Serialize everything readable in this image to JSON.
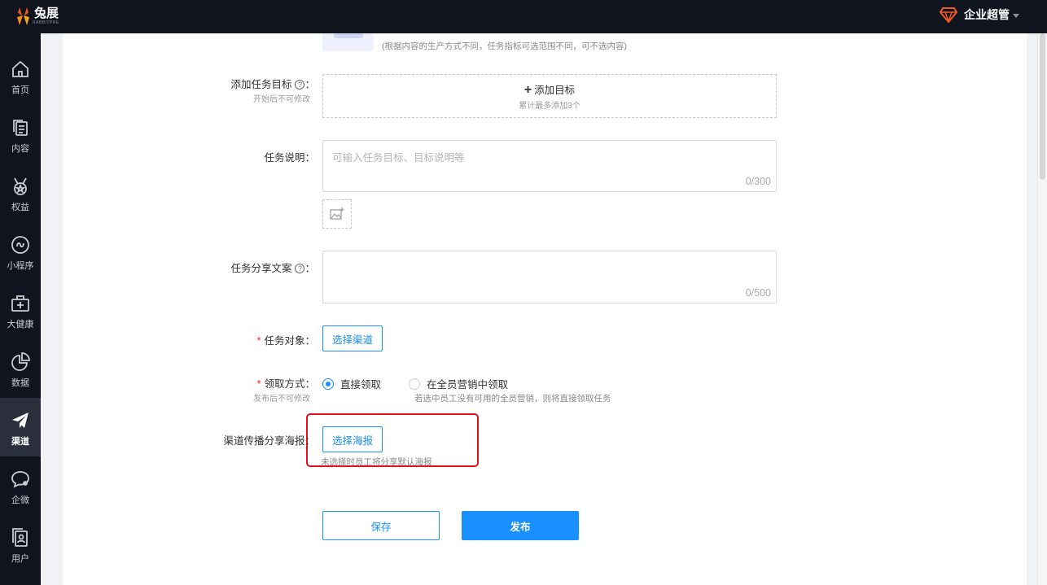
{
  "brand": {
    "name": "兔展",
    "sub": "RABBITPRE"
  },
  "user": {
    "name": "企业超管"
  },
  "colors": {
    "primary": "#1890ff",
    "sidebar_bg": "#10141f",
    "required": "#f5222d",
    "highlight": "#e5101d"
  },
  "sidebar": {
    "items": [
      {
        "label": "首页",
        "icon": "home-icon"
      },
      {
        "label": "内容",
        "icon": "document-copy-icon"
      },
      {
        "label": "权益",
        "icon": "medal-icon"
      },
      {
        "label": "小程序",
        "icon": "mini-program-icon"
      },
      {
        "label": "大健康",
        "icon": "medical-kit-icon"
      },
      {
        "label": "数据",
        "icon": "pie-chart-icon"
      },
      {
        "label": "渠道",
        "icon": "paper-plane-icon",
        "active": true
      },
      {
        "label": "企微",
        "icon": "chat-bubble-icon"
      },
      {
        "label": "用户",
        "icon": "user-card-icon"
      }
    ]
  },
  "form": {
    "upload_hint": "(根据内容的生产方式不同，任务指标可选范围不同，可不选内容)",
    "target": {
      "label": "添加任务目标",
      "sublabel": "开始后不可修改",
      "add_text": "添加目标",
      "add_hint": "累计最多添加3个"
    },
    "description": {
      "label": "任务说明",
      "placeholder": "可输入任务目标、目标说明等",
      "count": "0/300"
    },
    "share_copy": {
      "label": "任务分享文案",
      "count": "0/500"
    },
    "audience": {
      "label": "任务对象",
      "button": "选择渠道"
    },
    "claim": {
      "label": "领取方式",
      "sublabel": "发布后不可修改",
      "option1": "直接领取",
      "option2": "在全员营销中领取",
      "hint": "若选中员工没有可用的全员营销，则将直接领取任务",
      "selected": "直接领取"
    },
    "poster": {
      "label": "渠道传播分享海报",
      "button": "选择海报",
      "hint": "未选择时员工将分享默认海报"
    },
    "save_label": "保存",
    "publish_label": "发布"
  }
}
